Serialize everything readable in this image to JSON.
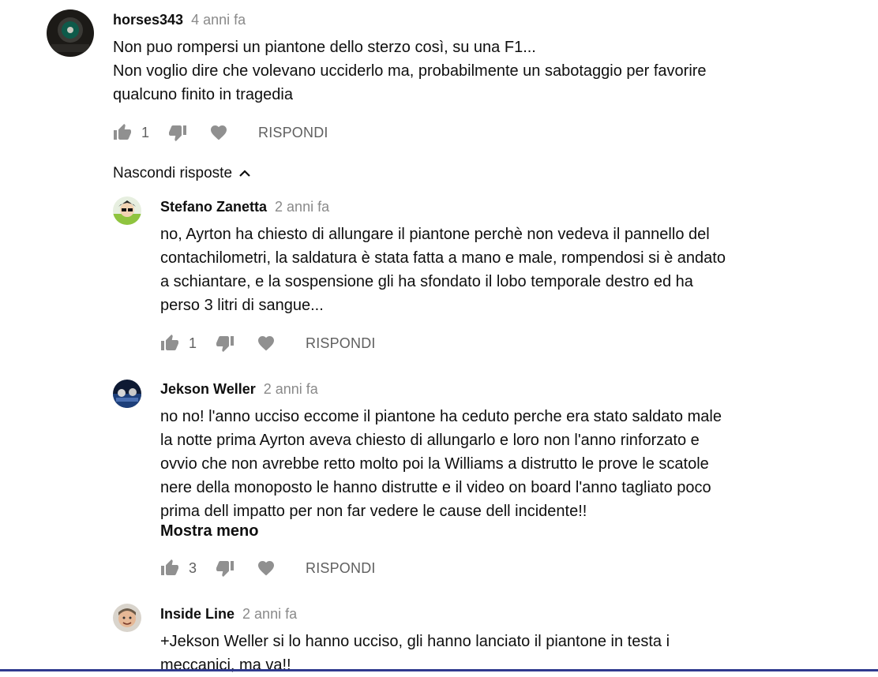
{
  "comments": [
    {
      "author": "horses343",
      "time": "4 anni fa",
      "lines": [
        "Non puo rompersi un piantone dello sterzo così, su una F1...",
        "Non voglio dire che volevano ucciderlo ma, probabilmente un sabotaggio per favorire",
        "qualcuno finito in tragedia"
      ],
      "likes": "1",
      "reply_label": "RISPONDI"
    }
  ],
  "replies_toggle": {
    "label": "Nascondi risposte",
    "icon": "chevron-up-icon"
  },
  "replies": [
    {
      "author": "Stefano Zanetta",
      "time": "2 anni fa",
      "lines": [
        "no, Ayrton ha chiesto di allungare il piantone perchè non vedeva il pannello del",
        "contachilometri, la saldatura è stata fatta a mano e male, rompendosi si è andato",
        "a schiantare, e la sospensione gli ha sfondato il lobo temporale destro ed ha",
        "perso 3 litri di sangue..."
      ],
      "likes": "1",
      "reply_label": "RISPONDI"
    },
    {
      "author": "Jekson Weller",
      "time": "2 anni fa",
      "lines": [
        "no no! l'anno ucciso eccome il piantone ha ceduto perche era stato saldato male",
        "la notte prima Ayrton aveva chiesto di allungarlo e loro non l'anno rinforzato e",
        "ovvio che non avrebbe retto molto poi la Williams a distrutto le prove le scatole",
        "nere della monoposto le hanno distrutte e il video on board l'anno tagliato poco",
        "prima dell impatto per non far vedere le cause dell incidente!!"
      ],
      "show_less": "Mostra meno",
      "likes": "3",
      "reply_label": "RISPONDI"
    },
    {
      "author": "Inside Line",
      "time": "2 anni fa",
      "lines": [
        "+Jekson Weller si lo hanno ucciso, gli hanno lanciato il piantone in testa i",
        "meccanici, ma va!!"
      ]
    }
  ],
  "icons": {
    "like": "thumb-up-icon",
    "dislike": "thumb-down-icon",
    "heart": "heart-icon"
  },
  "colors": {
    "text": "#0f0f0f",
    "muted": "#8a8a8a",
    "action": "#606060",
    "bottom_bar": "#2f3a8f"
  }
}
